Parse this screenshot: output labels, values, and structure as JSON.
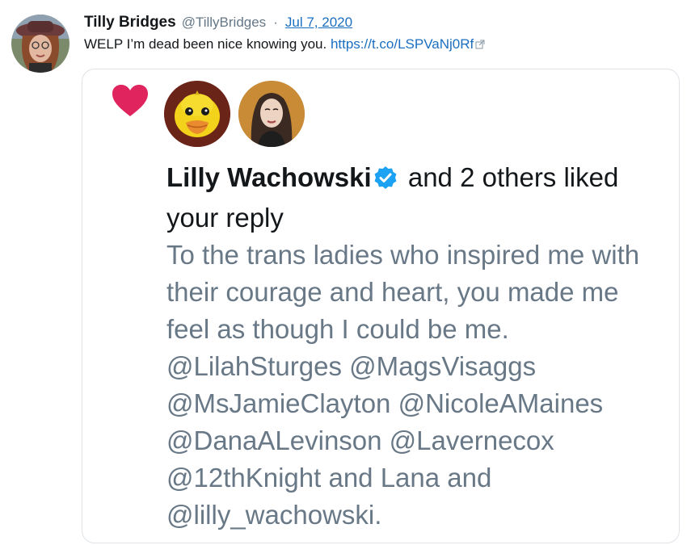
{
  "tweet": {
    "author": {
      "name": "Tilly Bridges",
      "handle": "@TillyBridges",
      "separator": "·",
      "date": "Jul 7, 2020"
    },
    "text": "WELP I’m dead been nice knowing you.",
    "link": "https://t.co/LSPVaNj0Rf",
    "link_icon": "external-link-icon"
  },
  "card": {
    "like_icon": "heart-icon",
    "likers": [
      "duck-avatar",
      "portrait-avatar"
    ],
    "notification": {
      "name": "Lilly Wachowski",
      "verified_icon": "verified-badge-icon",
      "action": "and 2 others liked your reply"
    },
    "quoted_text": "To the trans ladies who inspired me with their courage and heart, you made me feel as though I could be me. @LilahSturges @MagsVisaggs @MsJamieClayton @NicoleAMaines @DanaALevinson @Lavernecox @12thKnight and Lana and @lilly_wachowski."
  },
  "colors": {
    "heart": "#e0245e",
    "verified": "#1da1f2",
    "link": "#1b6fc0",
    "muted_text": "#687886"
  }
}
